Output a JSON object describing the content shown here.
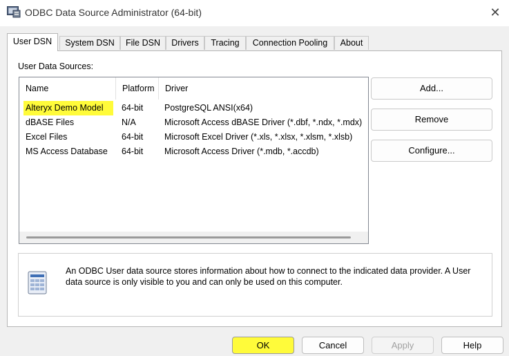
{
  "window": {
    "title": "ODBC Data Source Administrator (64-bit)",
    "close_label": "✕"
  },
  "tabs": [
    {
      "label": "User DSN",
      "active": true
    },
    {
      "label": "System DSN"
    },
    {
      "label": "File DSN"
    },
    {
      "label": "Drivers"
    },
    {
      "label": "Tracing"
    },
    {
      "label": "Connection Pooling"
    },
    {
      "label": "About"
    }
  ],
  "user_dsn": {
    "section_label": "User Data Sources:",
    "columns": [
      "Name",
      "Platform",
      "Driver"
    ],
    "rows": [
      {
        "name": "Alteryx Demo Model",
        "platform": "64-bit",
        "driver": "PostgreSQL ANSI(x64)"
      },
      {
        "name": "dBASE Files",
        "platform": "N/A",
        "driver": "Microsoft Access dBASE Driver (*.dbf, *.ndx, *.mdx)"
      },
      {
        "name": "Excel Files",
        "platform": "64-bit",
        "driver": "Microsoft Excel Driver (*.xls, *.xlsx, *.xlsm, *.xlsb)"
      },
      {
        "name": "MS Access Database",
        "platform": "64-bit",
        "driver": "Microsoft Access Driver (*.mdb, *.accdb)"
      }
    ],
    "buttons": {
      "add": "Add...",
      "remove": "Remove",
      "configure": "Configure..."
    },
    "info_text": "An ODBC User data source stores information about how to connect to the indicated data provider.   A User data source is only visible to you and can only be used on this computer."
  },
  "footer": {
    "ok": "OK",
    "cancel": "Cancel",
    "apply": "Apply",
    "help": "Help"
  },
  "colors": {
    "highlight": "#fffb3a"
  }
}
